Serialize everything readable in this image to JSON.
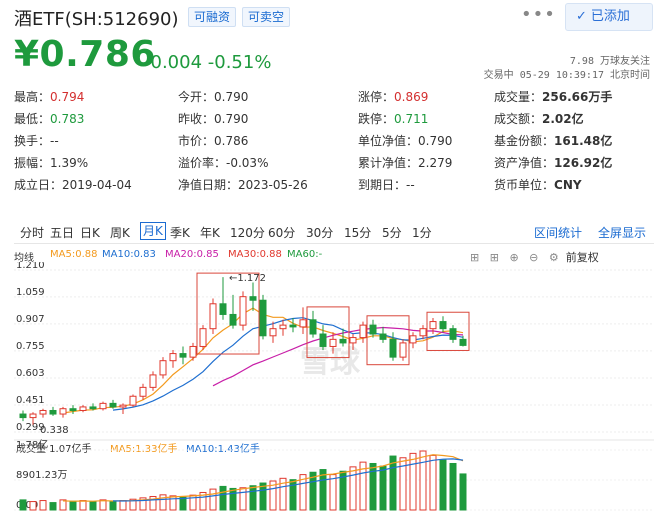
{
  "header": {
    "title": "酒ETF(SH:512690)",
    "tags": [
      "可融资",
      "可卖空"
    ],
    "more": "•••",
    "follow_btn": "已添加",
    "follow_check": "✓"
  },
  "price": {
    "current": "¥0.786",
    "change": "-0.004",
    "change_pct": "-0.51%",
    "followers": "7.98 万球友关注",
    "time": "交易中 05-29 10:39:17 北京时间"
  },
  "quote": [
    [
      {
        "k": "最高：",
        "v": "0.794",
        "c": "red"
      },
      {
        "k": "今开：",
        "v": "0.790",
        "c": ""
      },
      {
        "k": "涨停：",
        "v": "0.869",
        "c": "red"
      },
      {
        "k": "成交量：",
        "v": "256.66万手",
        "c": "bold"
      }
    ],
    [
      {
        "k": "最低：",
        "v": "0.783",
        "c": "green"
      },
      {
        "k": "昨收：",
        "v": "0.790",
        "c": ""
      },
      {
        "k": "跌停：",
        "v": "0.711",
        "c": "green"
      },
      {
        "k": "成交额：",
        "v": "2.02亿",
        "c": "bold"
      }
    ],
    [
      {
        "k": "换手：",
        "v": "--",
        "c": ""
      },
      {
        "k": "市价：",
        "v": "0.786",
        "c": ""
      },
      {
        "k": "单位净值：",
        "v": "0.790",
        "c": ""
      },
      {
        "k": "基金份额：",
        "v": "161.48亿",
        "c": "bold"
      }
    ],
    [
      {
        "k": "振幅：",
        "v": "1.39%",
        "c": ""
      },
      {
        "k": "溢价率：",
        "v": "-0.03%",
        "c": ""
      },
      {
        "k": "累计净值：",
        "v": "2.279",
        "c": ""
      },
      {
        "k": "资产净值：",
        "v": "126.92亿",
        "c": "bold"
      }
    ],
    [
      {
        "k": "成立日：",
        "v": "2019-04-04",
        "c": ""
      },
      {
        "k": "净值日期：",
        "v": "2023-05-26",
        "c": ""
      },
      {
        "k": "到期日：",
        "v": "--",
        "c": ""
      },
      {
        "k": "货币单位：",
        "v": "CNY",
        "c": "bold"
      }
    ]
  ],
  "periods": [
    "分时",
    "五日",
    "日K",
    "周K",
    "月K",
    "季K",
    "年K",
    "120分",
    "60分",
    "30分",
    "15分",
    "5分",
    "1分"
  ],
  "active_period": "月K",
  "links": [
    "区间统计",
    "全屏显示"
  ],
  "ma": {
    "label": "均线",
    "ma5": "MA5:0.88",
    "ma10": "MA10:0.83",
    "ma20": "MA20:0.85",
    "ma30": "MA30:0.88",
    "ma60": "MA60:-",
    "adjust": "前复权",
    "colors": {
      "ma5": "#f39a1e",
      "ma10": "#1f6fd0",
      "ma20": "#c81fa8",
      "ma30": "#e0382e",
      "ma60": "#1e9a3d"
    }
  },
  "volume": {
    "label": "成交量 1.07亿手",
    "ma5": "MA5:1.33亿手",
    "ma10": "MA10:1.43亿手",
    "ticks": [
      "1.78亿",
      "8901.23万",
      "0.00"
    ]
  },
  "chart_data": {
    "type": "candlestick",
    "y_ticks": [
      "1.210",
      "1.059",
      "0.907",
      "0.755",
      "0.603",
      "0.451",
      "0.299"
    ],
    "ylim": [
      0.299,
      1.21
    ],
    "annotations": {
      "high": "1.172",
      "low": "0.338"
    },
    "watermark": "雪球",
    "candles": [
      {
        "o": 0.4,
        "h": 0.42,
        "l": 0.36,
        "c": 0.38
      },
      {
        "o": 0.38,
        "h": 0.41,
        "l": 0.34,
        "c": 0.4
      },
      {
        "o": 0.4,
        "h": 0.43,
        "l": 0.38,
        "c": 0.42
      },
      {
        "o": 0.42,
        "h": 0.44,
        "l": 0.39,
        "c": 0.4
      },
      {
        "o": 0.4,
        "h": 0.44,
        "l": 0.38,
        "c": 0.43
      },
      {
        "o": 0.43,
        "h": 0.45,
        "l": 0.4,
        "c": 0.42
      },
      {
        "o": 0.42,
        "h": 0.45,
        "l": 0.41,
        "c": 0.44
      },
      {
        "o": 0.44,
        "h": 0.46,
        "l": 0.42,
        "c": 0.43
      },
      {
        "o": 0.43,
        "h": 0.47,
        "l": 0.42,
        "c": 0.46
      },
      {
        "o": 0.46,
        "h": 0.48,
        "l": 0.43,
        "c": 0.44
      },
      {
        "o": 0.44,
        "h": 0.46,
        "l": 0.4,
        "c": 0.45
      },
      {
        "o": 0.45,
        "h": 0.51,
        "l": 0.44,
        "c": 0.5
      },
      {
        "o": 0.5,
        "h": 0.57,
        "l": 0.48,
        "c": 0.55
      },
      {
        "o": 0.55,
        "h": 0.64,
        "l": 0.53,
        "c": 0.62
      },
      {
        "o": 0.62,
        "h": 0.72,
        "l": 0.6,
        "c": 0.7
      },
      {
        "o": 0.7,
        "h": 0.76,
        "l": 0.66,
        "c": 0.74
      },
      {
        "o": 0.74,
        "h": 0.78,
        "l": 0.68,
        "c": 0.72
      },
      {
        "o": 0.72,
        "h": 0.8,
        "l": 0.7,
        "c": 0.78
      },
      {
        "o": 0.78,
        "h": 0.9,
        "l": 0.76,
        "c": 0.88
      },
      {
        "o": 0.88,
        "h": 1.05,
        "l": 0.85,
        "c": 1.02
      },
      {
        "o": 1.02,
        "h": 1.17,
        "l": 0.93,
        "c": 0.96
      },
      {
        "o": 0.96,
        "h": 1.07,
        "l": 0.88,
        "c": 0.9
      },
      {
        "o": 0.9,
        "h": 1.09,
        "l": 0.87,
        "c": 1.06
      },
      {
        "o": 1.06,
        "h": 1.14,
        "l": 0.98,
        "c": 1.04
      },
      {
        "o": 1.04,
        "h": 1.07,
        "l": 0.82,
        "c": 0.84
      },
      {
        "o": 0.84,
        "h": 0.92,
        "l": 0.8,
        "c": 0.88
      },
      {
        "o": 0.88,
        "h": 0.93,
        "l": 0.84,
        "c": 0.9
      },
      {
        "o": 0.9,
        "h": 0.94,
        "l": 0.86,
        "c": 0.89
      },
      {
        "o": 0.89,
        "h": 1.0,
        "l": 0.85,
        "c": 0.93
      },
      {
        "o": 0.93,
        "h": 0.98,
        "l": 0.83,
        "c": 0.85
      },
      {
        "o": 0.85,
        "h": 0.9,
        "l": 0.76,
        "c": 0.78
      },
      {
        "o": 0.78,
        "h": 0.86,
        "l": 0.74,
        "c": 0.82
      },
      {
        "o": 0.82,
        "h": 0.88,
        "l": 0.78,
        "c": 0.8
      },
      {
        "o": 0.8,
        "h": 0.85,
        "l": 0.76,
        "c": 0.83
      },
      {
        "o": 0.83,
        "h": 0.92,
        "l": 0.8,
        "c": 0.9
      },
      {
        "o": 0.9,
        "h": 0.93,
        "l": 0.83,
        "c": 0.85
      },
      {
        "o": 0.85,
        "h": 0.89,
        "l": 0.8,
        "c": 0.82
      },
      {
        "o": 0.82,
        "h": 0.86,
        "l": 0.7,
        "c": 0.72
      },
      {
        "o": 0.72,
        "h": 0.82,
        "l": 0.7,
        "c": 0.8
      },
      {
        "o": 0.8,
        "h": 0.86,
        "l": 0.77,
        "c": 0.84
      },
      {
        "o": 0.84,
        "h": 0.9,
        "l": 0.82,
        "c": 0.88
      },
      {
        "o": 0.88,
        "h": 0.94,
        "l": 0.85,
        "c": 0.92
      },
      {
        "o": 0.92,
        "h": 0.95,
        "l": 0.86,
        "c": 0.88
      },
      {
        "o": 0.88,
        "h": 0.9,
        "l": 0.8,
        "c": 0.82
      },
      {
        "o": 0.82,
        "h": 0.84,
        "l": 0.78,
        "c": 0.786
      }
    ],
    "volumes": [
      0.3,
      0.25,
      0.28,
      0.22,
      0.3,
      0.26,
      0.28,
      0.24,
      0.3,
      0.26,
      0.28,
      0.32,
      0.36,
      0.4,
      0.45,
      0.42,
      0.38,
      0.44,
      0.52,
      0.62,
      0.7,
      0.64,
      0.66,
      0.72,
      0.8,
      0.86,
      0.94,
      0.9,
      1.05,
      1.12,
      1.2,
      1.05,
      1.15,
      1.28,
      1.42,
      1.38,
      1.3,
      1.6,
      1.55,
      1.68,
      1.75,
      1.62,
      1.48,
      1.38,
      1.07
    ]
  }
}
